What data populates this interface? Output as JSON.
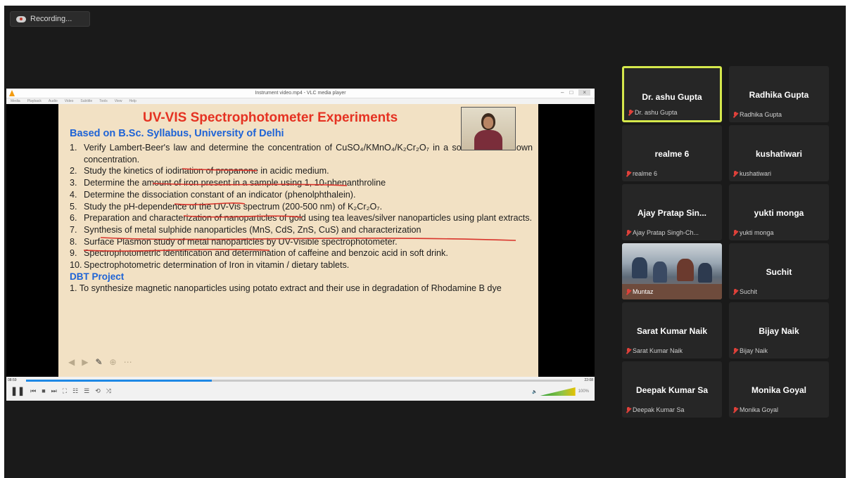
{
  "recording": {
    "label": "Recording..."
  },
  "vlc": {
    "title": "Instrument video.mp4 - VLC media player",
    "menu": [
      "Media",
      "Playback",
      "Audio",
      "Video",
      "Subtitle",
      "Tools",
      "View",
      "Help"
    ],
    "time_elapsed": "08:59",
    "time_total": "22:08",
    "progress": 0.34,
    "volume": "100%"
  },
  "slide": {
    "title": "UV-VIS Spectrophotometer Experiments",
    "subtitle": "Based on B.Sc. Syllabus, University of Delhi",
    "items": [
      {
        "n": "1.",
        "t": "Verify Lambert-Beer's law and determine the concentration of CuSO₄/KMnO₄/K₂Cr₂O₇ in a solution of unknown concentration."
      },
      {
        "n": "2.",
        "t": "Study the kinetics of iodination of propanone in acidic medium."
      },
      {
        "n": "3.",
        "t": "Determine the amount of iron present in a sample using 1, 10-phenanthroline"
      },
      {
        "n": "4.",
        "t": "Determine the dissociation constant of an indicator (phenolphthalein)."
      },
      {
        "n": "5.",
        "t": "Study the pH-dependence of the UV-Vis spectrum (200-500 nm) of K₂Cr₂O₇."
      },
      {
        "n": "6.",
        "t": "Preparation and characterization of nanoparticles of gold using tea leaves/silver nanoparticles using plant extracts."
      },
      {
        "n": "7.",
        "t": "Synthesis of metal sulphide nanoparticles (MnS, CdS, ZnS, CuS) and characterization"
      },
      {
        "n": "8.",
        "t": "Surface Plasmon study of metal nanoparticles by UV-Visible spectrophotometer."
      },
      {
        "n": "9.",
        "t": "Spectrophotometric identification and determination of caffeine and benzoic acid in soft drink."
      },
      {
        "n": "10.",
        "t": "Spectrophotometric determination of Iron in vitamin / dietary tablets."
      }
    ],
    "dbt_title": "DBT Project",
    "dbt_item": "1. To synthesize magnetic nanoparticles using potato extract and their use in degradation of Rhodamine B dye"
  },
  "participants": [
    {
      "name": "Dr. ashu Gupta",
      "label": "Dr. ashu Gupta",
      "active": true
    },
    {
      "name": "Radhika Gupta",
      "label": "Radhika Gupta"
    },
    {
      "name": "realme 6",
      "label": "realme 6"
    },
    {
      "name": "kushatiwari",
      "label": "kushatiwari"
    },
    {
      "name": "Ajay Pratap Sin...",
      "label": "Ajay Pratap Singh-Ch..."
    },
    {
      "name": "yukti monga",
      "label": "yukti monga"
    },
    {
      "name": "",
      "label": "Muntaz",
      "video": true
    },
    {
      "name": "Suchit",
      "label": "Suchit"
    },
    {
      "name": "Sarat Kumar Naik",
      "label": "Sarat Kumar Naik"
    },
    {
      "name": "Bijay Naik",
      "label": "Bijay Naik"
    },
    {
      "name": "Deepak Kumar Sa",
      "label": "Deepak Kumar Sa"
    },
    {
      "name": "Monika Goyal",
      "label": "Monika Goyal"
    }
  ]
}
